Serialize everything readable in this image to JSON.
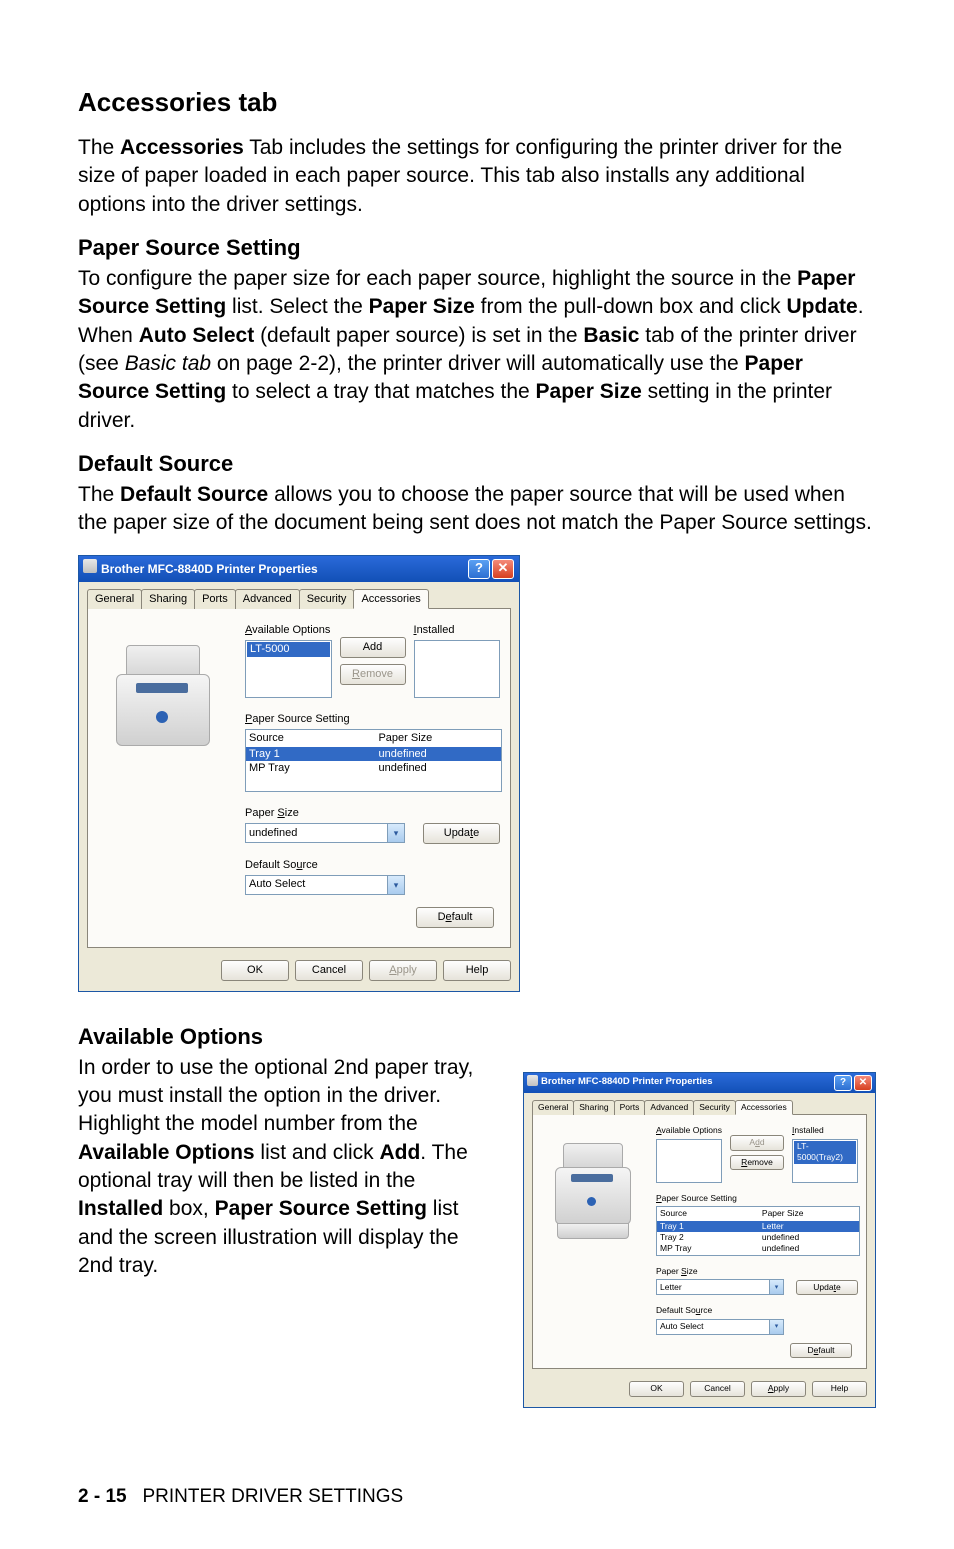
{
  "heading1": "Accessories tab",
  "intro": {
    "pre": "The ",
    "bold1": "Accessories",
    "post": " Tab includes the settings for configuring the printer driver for the size of paper loaded in each paper source. This tab also installs any additional options into the driver settings."
  },
  "pss": {
    "h": "Paper Source Setting",
    "t": {
      "a": "To configure the paper size for each paper source, highlight the source in the ",
      "b1": "Paper Source Setting",
      "b": " list. Select the ",
      "b2": "Paper Size",
      "c": " from the pull-down box and click ",
      "b3": "Update",
      "d": ". When ",
      "b4": "Auto Select",
      "e": " (default paper source) is set in the ",
      "b5": "Basic",
      "f": " tab of the printer driver (see ",
      "i1": "Basic tab",
      "g": " on page 2-2), the printer driver will automatically use the ",
      "b6": "Paper Source Setting",
      "h2": " to select a tray that matches the ",
      "b7": "Paper Size",
      "i": " setting in the printer driver."
    }
  },
  "ds": {
    "h": "Default Source",
    "t": {
      "a": "The ",
      "b1": "Default Source",
      "b": " allows you to choose the paper source that will be used when the paper size of the document being sent does not match the Paper Source settings."
    }
  },
  "avail": {
    "h": "Available Options",
    "t": {
      "a": "In order to use the optional 2nd paper tray, you must install the option in the driver. Highlight the model number from the ",
      "b1": "Available Options",
      "b": " list and click ",
      "b2": "Add",
      "c": ". The optional tray will then be listed in the ",
      "b3": "Installed",
      "d": " box, ",
      "b4": "Paper Source Setting",
      "e": " list and the screen illustration will display the 2nd tray."
    }
  },
  "dialog1": {
    "title": "Brother MFC-8840D Printer Properties",
    "tabs": [
      "General",
      "Sharing",
      "Ports",
      "Advanced",
      "Security",
      "Accessories"
    ],
    "activeTab": "Accessories",
    "labels": {
      "availableOptions": "Available Options",
      "installed": "Installed",
      "add": "Add",
      "remove": "Remove",
      "pss": "Paper Source Setting",
      "sourceCol": "Source",
      "sizeCol": "Paper Size",
      "paperSize": "Paper Size",
      "defaultSource": "Default Source",
      "update": "Update",
      "default": "Default",
      "ok": "OK",
      "cancel": "Cancel",
      "apply": "Apply",
      "help": "Help"
    },
    "availableOptionsItems": [
      {
        "text": "LT-5000",
        "sel": true
      }
    ],
    "installedItems": [],
    "pssRows": [
      {
        "source": "Tray 1",
        "size": "undefined",
        "sel": true
      },
      {
        "source": "MP Tray",
        "size": "undefined",
        "sel": false
      }
    ],
    "paperSizeValue": "undefined",
    "defaultSourceValue": "Auto Select",
    "addEnabled": true,
    "removeEnabled": false,
    "applyEnabled": false
  },
  "dialog2": {
    "title": "Brother MFC-8840D Printer Properties",
    "tabs": [
      "General",
      "Sharing",
      "Ports",
      "Advanced",
      "Security",
      "Accessories"
    ],
    "activeTab": "Accessories",
    "labels": {
      "availableOptions": "Available Options",
      "installed": "Installed",
      "add": "Add",
      "remove": "Remove",
      "pss": "Paper Source Setting",
      "sourceCol": "Source",
      "sizeCol": "Paper Size",
      "paperSize": "Paper Size",
      "defaultSource": "Default Source",
      "update": "Update",
      "default": "Default",
      "ok": "OK",
      "cancel": "Cancel",
      "apply": "Apply",
      "help": "Help"
    },
    "availableOptionsItems": [],
    "installedItems": [
      {
        "text": "LT-5000(Tray2)",
        "sel": true
      }
    ],
    "pssRows": [
      {
        "source": "Tray 1",
        "size": "Letter",
        "sel": true
      },
      {
        "source": "Tray 2",
        "size": "undefined",
        "sel": false
      },
      {
        "source": "MP Tray",
        "size": "undefined",
        "sel": false
      }
    ],
    "paperSizeValue": "Letter",
    "defaultSourceValue": "Auto Select",
    "addEnabled": false,
    "removeEnabled": true,
    "applyEnabled": true
  },
  "footer": {
    "page": "2 - 15",
    "section": "PRINTER DRIVER SETTINGS"
  }
}
